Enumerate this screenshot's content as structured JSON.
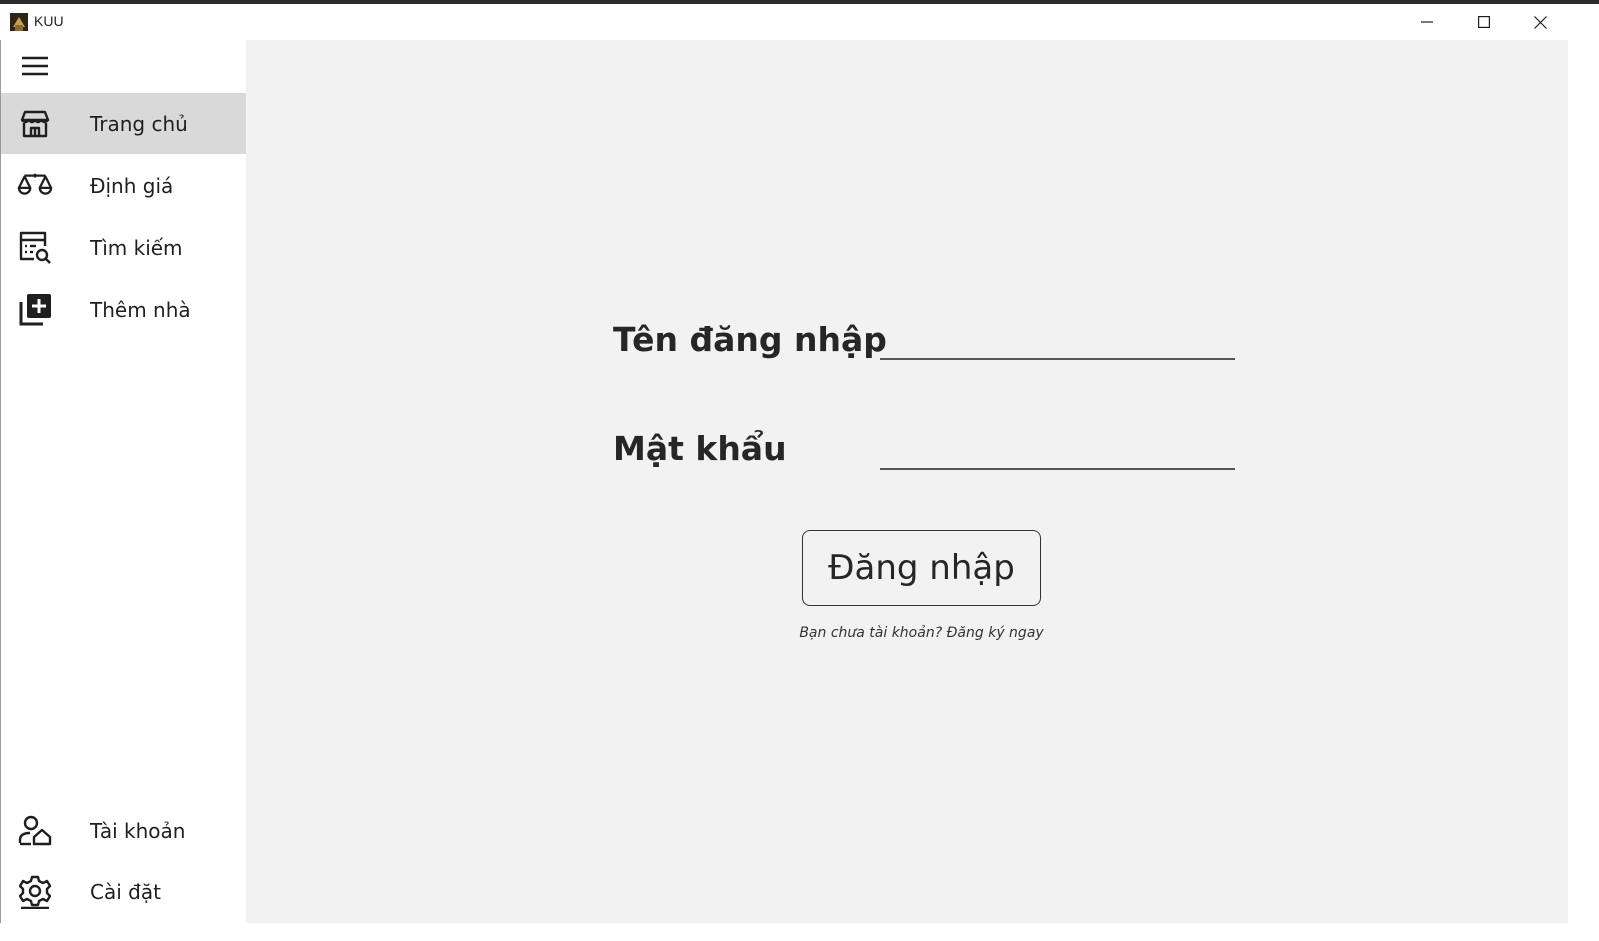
{
  "window": {
    "title": "KUU",
    "controls": [
      "minimize-icon",
      "maximize-icon",
      "close-icon"
    ]
  },
  "sidebar": {
    "menu_icon": "hamburger-menu-icon",
    "items": [
      {
        "label": "Trang chủ",
        "icon": "store-icon",
        "active": true
      },
      {
        "label": "Định giá",
        "icon": "scale-icon",
        "active": false
      },
      {
        "label": "Tìm kiếm",
        "icon": "search-list-icon",
        "active": false
      },
      {
        "label": "Thêm nhà",
        "icon": "add-box-icon",
        "active": false
      }
    ],
    "bottom_items": [
      {
        "label": "Tài khoản",
        "icon": "user-home-icon"
      },
      {
        "label": "Cài đặt",
        "icon": "gear-icon"
      }
    ]
  },
  "login": {
    "username_label": "Tên đăng nhập",
    "username_value": "",
    "password_label": "Mật khẩu",
    "password_value": "",
    "submit_label": "Đăng nhập",
    "signup_prompt": "Bạn chưa tài khoản? Đăng ký ngay"
  },
  "colors": {
    "active_nav_bg": "#d9d9d9",
    "content_bg": "#f2f2f2",
    "text": "#262626"
  }
}
